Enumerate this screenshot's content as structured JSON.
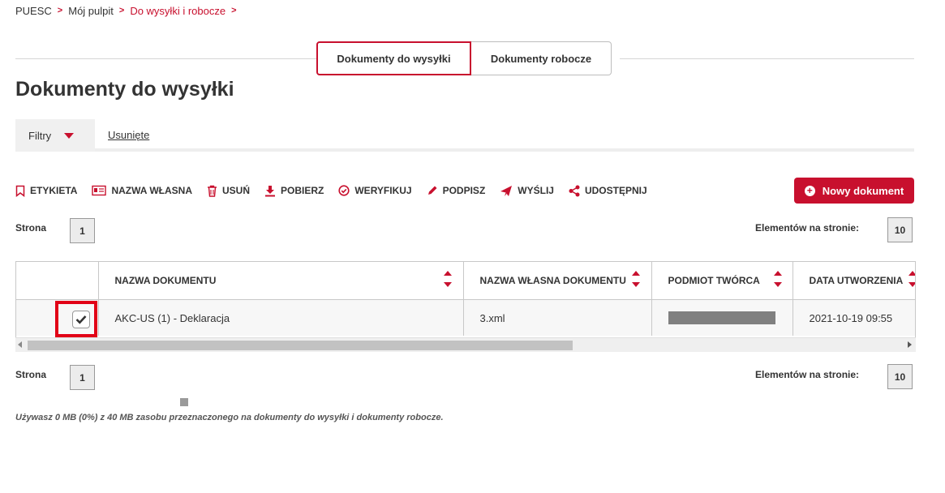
{
  "breadcrumb": {
    "items": [
      "PUESC",
      "Mój pulpit",
      "Do wysyłki i robocze"
    ]
  },
  "tabs": {
    "active": "Dokumenty do wysyłki",
    "inactive": "Dokumenty robocze"
  },
  "page_title": "Dokumenty do wysyłki",
  "filters": {
    "filters_label": "Filtry",
    "removed_label": "Usunięte"
  },
  "toolbar": {
    "label": "ETYKIETA",
    "custom_name": "NAZWA WŁASNA",
    "delete": "USUŃ",
    "download": "POBIERZ",
    "verify": "WERYFIKUJ",
    "sign": "PODPISZ",
    "send": "WYŚLIJ",
    "share": "UDOSTĘPNIJ",
    "new_document": "Nowy dokument"
  },
  "pagination": {
    "page_label": "Strona",
    "page_value": "1",
    "per_page_label": "Elementów na stronie:",
    "per_page_value": "10"
  },
  "table": {
    "columns": [
      "NAZWA DOKUMENTU",
      "NAZWA WŁASNA DOKUMENTU",
      "PODMIOT TWÓRCA",
      "DATA UTWORZENIA"
    ],
    "rows": [
      {
        "name": "AKC-US (1) - Deklaracja",
        "custom_name": "3.xml",
        "creator": "",
        "created": "2021-10-19 09:55",
        "checked": true
      }
    ]
  },
  "usage_note": "Używasz 0 MB (0%) z 40 MB zasobu przeznaczonego na dokumenty do wysyłki i dokumenty robocze.",
  "colors": {
    "accent": "#c8102e",
    "highlight": "#e10016"
  }
}
